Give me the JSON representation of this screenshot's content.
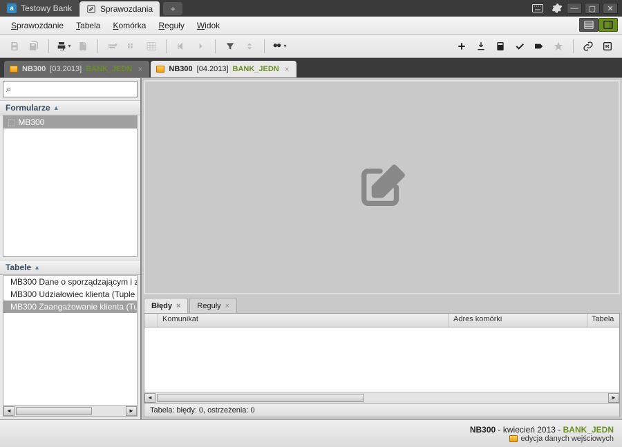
{
  "title_tabs": [
    {
      "label": "Testowy Bank",
      "active": false
    },
    {
      "label": "Sprawozdania",
      "active": true
    }
  ],
  "menu": {
    "items": [
      "Sprawozdanie",
      "Tabela",
      "Komórka",
      "Reguły",
      "Widok"
    ]
  },
  "doc_tabs": [
    {
      "code": "NB300",
      "period": "[03.2013]",
      "entity": "BANK_JEDN",
      "active": false
    },
    {
      "code": "NB300",
      "period": "[04.2013]",
      "entity": "BANK_JEDN",
      "active": true
    }
  ],
  "sidebar": {
    "search_placeholder": "",
    "formularze_hdr": "Formularze",
    "formularze_items": [
      "MB300"
    ],
    "tabele_hdr": "Tabele",
    "tabele_items": [
      "MB300 Dane o sporządzającym i z",
      "MB300 Udziałowiec klienta (Tuple",
      "MB300 Zaangażowanie klienta (Tu"
    ],
    "tabele_selected": 2
  },
  "messages": {
    "tabs": [
      "Błędy",
      "Reguły"
    ],
    "active_tab": 0,
    "columns": [
      "",
      "Komunikat",
      "Adres komórki",
      "Tabela"
    ],
    "status": "Tabela: błędy: 0, ostrzeżenia: 0"
  },
  "footer": {
    "code": "NB300",
    "period_text": "kwiecień 2013",
    "entity": "BANK_JEDN",
    "mode": "edycja danych wejściowych"
  }
}
